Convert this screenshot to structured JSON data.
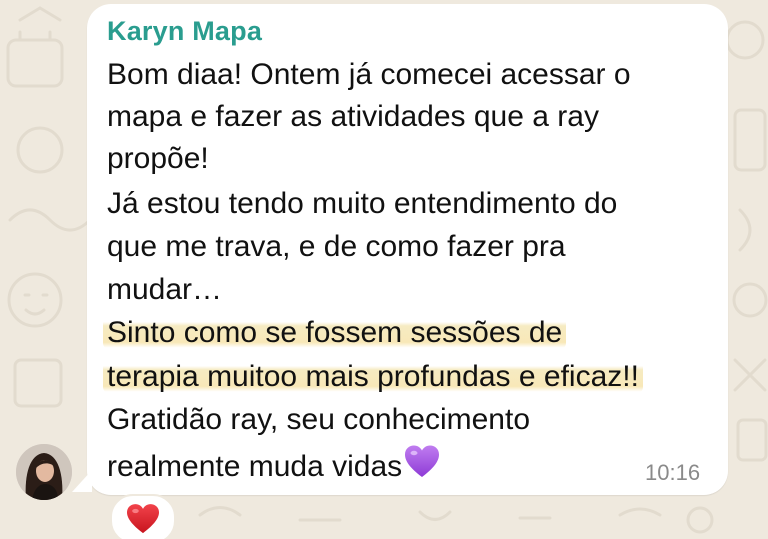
{
  "message": {
    "sender": "Karyn Mapa",
    "lines": [
      "Bom diaa! Ontem já comecei acessar o",
      "mapa e fazer as atividades que a ray",
      "propõe!",
      "Já estou tendo muito entendimento do",
      "que me trava, e de como fazer pra",
      "mudar…",
      "Sinto como se fossem sessões de",
      "terapia muitoo mais profundas e eficaz!!",
      "Gratidão ray, seu conhecimento",
      "realmente muda vidas"
    ],
    "highlighted_line_indices": [
      6,
      7
    ],
    "trailing_emoji_icon": "purple-heart-icon",
    "time": "10:16"
  },
  "reaction": {
    "icon": "red-heart-icon"
  },
  "colors": {
    "sender": "#2a9d8f",
    "highlight": "#f8e8b8",
    "background": "#efe9de",
    "bubble": "#ffffff"
  }
}
